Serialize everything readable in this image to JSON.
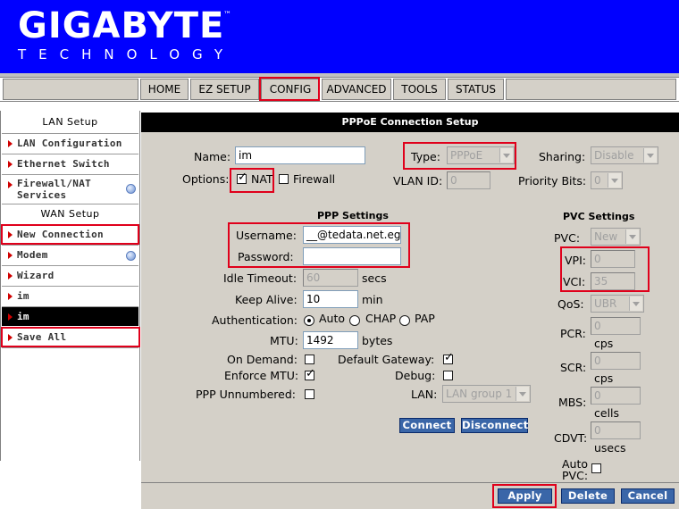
{
  "brand": {
    "name": "GIGABYTE",
    "tm": "™",
    "tagline": "TECHNOLOGY"
  },
  "nav": {
    "tabs": [
      {
        "label": "HOME"
      },
      {
        "label": "EZ SETUP"
      },
      {
        "label": "CONFIG"
      },
      {
        "label": "ADVANCED"
      },
      {
        "label": "TOOLS"
      },
      {
        "label": "STATUS"
      }
    ],
    "active": "CONFIG"
  },
  "sidebar": {
    "lan_heading": "LAN Setup",
    "wan_heading": "WAN Setup",
    "items": [
      {
        "label": "LAN Configuration"
      },
      {
        "label": "Ethernet Switch"
      },
      {
        "label": "Firewall/NAT",
        "label2": "Services"
      },
      {
        "label": "New Connection"
      },
      {
        "label": "Modem"
      },
      {
        "label": "Wizard"
      },
      {
        "label": "im"
      },
      {
        "label": "im"
      },
      {
        "label": "Save All"
      }
    ]
  },
  "panel": {
    "title": "PPPoE Connection Setup",
    "name_label": "Name:",
    "name_value": "im",
    "type_label": "Type:",
    "type_value": "PPPoE",
    "sharing_label": "Sharing:",
    "sharing_value": "Disable",
    "options_label": "Options:",
    "nat_label": "NAT",
    "firewall_label": "Firewall",
    "vlan_label": "VLAN ID:",
    "vlan_value": "0",
    "priority_label": "Priority Bits:",
    "priority_value": "0",
    "ppp_heading": "PPP Settings",
    "username_label": "Username:",
    "username_value": "__@tedata.net.eg",
    "password_label": "Password:",
    "password_value": "",
    "idle_label": "Idle Timeout:",
    "idle_value": "60",
    "idle_unit": "secs",
    "keepalive_label": "Keep Alive:",
    "keepalive_value": "10",
    "keepalive_unit": "min",
    "auth_label": "Authentication:",
    "auth_options": [
      "Auto",
      "CHAP",
      "PAP"
    ],
    "auth_selected": "Auto",
    "mtu_label": "MTU:",
    "mtu_value": "1492",
    "mtu_unit": "bytes",
    "ondemand_label": "On Demand:",
    "enforce_label": "Enforce MTU:",
    "unnumbered_label": "PPP Unnumbered:",
    "gateway_label": "Default Gateway:",
    "debug_label": "Debug:",
    "lan_label": "LAN:",
    "lan_value": "LAN group 1",
    "connect_label": "Connect",
    "disconnect_label": "Disconnect",
    "pvc_heading": "PVC Settings",
    "pvc_label": "PVC:",
    "pvc_value": "New",
    "vpi_label": "VPI:",
    "vpi_value": "0",
    "vci_label": "VCI:",
    "vci_value": "35",
    "qos_label": "QoS:",
    "qos_value": "UBR",
    "pcr_label": "PCR:",
    "pcr_value": "0",
    "pcr_unit": "cps",
    "scr_label": "SCR:",
    "scr_value": "0",
    "scr_unit": "cps",
    "mbs_label": "MBS:",
    "mbs_value": "0",
    "mbs_unit": "cells",
    "cdvt_label": "CDVT:",
    "cdvt_value": "0",
    "cdvt_unit": "usecs",
    "autopvc_label": "Auto",
    "autopvc_label2": "PVC:"
  },
  "actions": {
    "apply": "Apply",
    "delete": "Delete",
    "cancel": "Cancel"
  },
  "colors": {
    "header_blue": "#0000ff",
    "highlight_red": "#e0001b",
    "button_blue": "#3a66a8",
    "panel_gray": "#d4d0c8"
  }
}
